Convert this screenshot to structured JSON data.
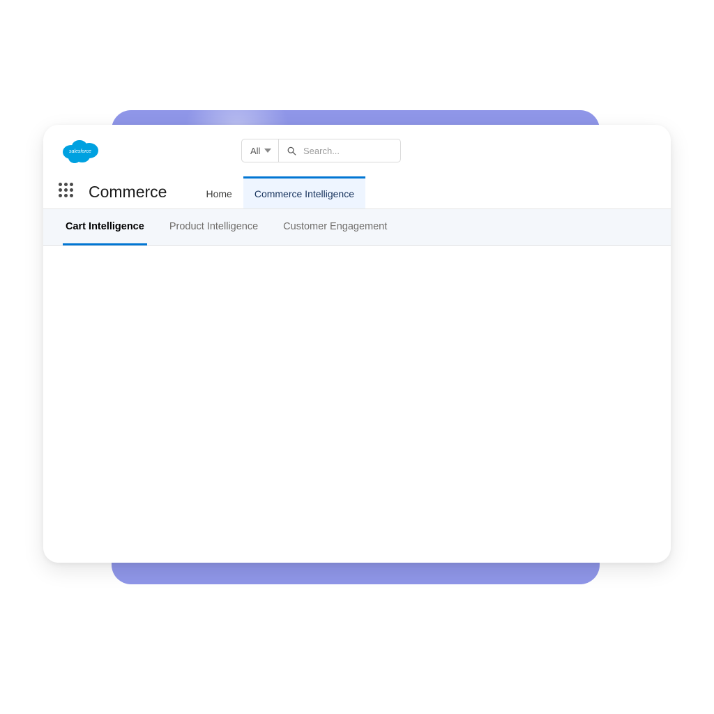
{
  "brand": {
    "logo_text": "salesforce"
  },
  "search": {
    "scope_label": "All",
    "placeholder": "Search..."
  },
  "nav": {
    "app_name": "Commerce",
    "tabs": [
      {
        "label": "Home",
        "active": false
      },
      {
        "label": "Commerce Intelligence",
        "active": true
      }
    ]
  },
  "subtabs": {
    "items": [
      {
        "label": "Cart Intelligence",
        "active": true
      },
      {
        "label": "Product Intelligence",
        "active": false
      },
      {
        "label": "Customer Engagement",
        "active": false
      }
    ]
  },
  "colors": {
    "brand_blue": "#00a1e0",
    "tab_active_border": "#0176d3",
    "purple_backdrop": "#8f96e8"
  }
}
